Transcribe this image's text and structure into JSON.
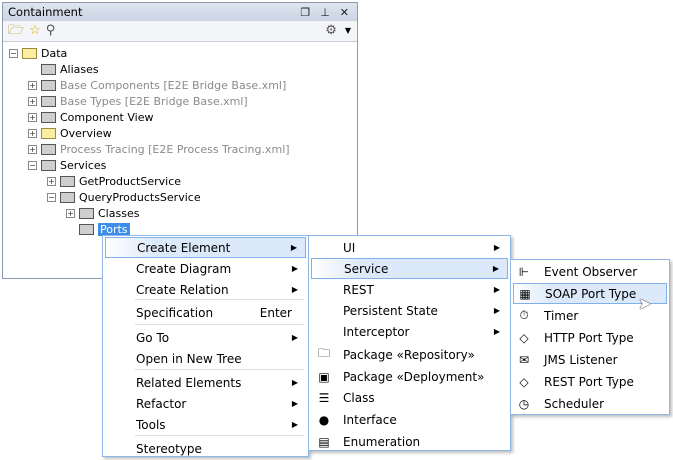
{
  "panel": {
    "title": "Containment",
    "icons": [
      "restore-icon",
      "pin-icon",
      "close-icon"
    ],
    "toolbar": [
      "open-folder-icon",
      "star-icon",
      "search-icon",
      "gear-icon",
      "dropdown-icon"
    ]
  },
  "tree": [
    {
      "label": "Data",
      "level": 0,
      "expander": "minus",
      "folder": "data",
      "style": "normal"
    },
    {
      "label": "Aliases",
      "level": 1,
      "expander": "none",
      "folder": "gray",
      "style": "normal"
    },
    {
      "label": "Base Components [E2E Bridge Base.xml]",
      "level": 1,
      "expander": "plus",
      "folder": "shared",
      "style": "gray"
    },
    {
      "label": "Base Types [E2E Bridge Base.xml]",
      "level": 1,
      "expander": "plus",
      "folder": "shared",
      "style": "gray"
    },
    {
      "label": "Component View",
      "level": 1,
      "expander": "plus",
      "folder": "gray",
      "style": "normal"
    },
    {
      "label": "Overview",
      "level": 1,
      "expander": "plus",
      "folder": "yellow",
      "style": "normal"
    },
    {
      "label": "Process Tracing [E2E Process Tracing.xml]",
      "level": 1,
      "expander": "plus",
      "folder": "shared",
      "style": "gray"
    },
    {
      "label": "Services",
      "level": 1,
      "expander": "minus",
      "folder": "gray",
      "style": "normal"
    },
    {
      "label": "GetProductService",
      "level": 2,
      "expander": "plus",
      "folder": "gray",
      "style": "normal"
    },
    {
      "label": "QueryProductsService",
      "level": 2,
      "expander": "minus",
      "folder": "gray",
      "style": "normal"
    },
    {
      "label": "Classes",
      "level": 3,
      "expander": "plus",
      "folder": "gray",
      "style": "normal"
    },
    {
      "label": "Ports",
      "level": 3,
      "expander": "none",
      "folder": "gray",
      "style": "selected"
    }
  ],
  "menu1": {
    "items": [
      {
        "label": "Create Element",
        "submenu": true,
        "highlighted": true
      },
      {
        "label": "Create Diagram",
        "submenu": true
      },
      {
        "label": "Create Relation",
        "submenu": true
      },
      {
        "label": "Specification",
        "shortcut": "Enter"
      },
      {
        "label": "Go To",
        "submenu": true
      },
      {
        "label": "Open in New Tree"
      },
      {
        "label": "Related Elements",
        "submenu": true
      },
      {
        "label": "Refactor",
        "submenu": true
      },
      {
        "label": "Tools",
        "submenu": true
      },
      {
        "label": "Stereotype"
      }
    ]
  },
  "menu2": {
    "items": [
      {
        "label": "UI",
        "submenu": true
      },
      {
        "label": "Service",
        "submenu": true,
        "highlighted": true
      },
      {
        "label": "REST",
        "submenu": true
      },
      {
        "label": "Persistent State",
        "submenu": true
      },
      {
        "label": "Interceptor",
        "submenu": true
      },
      {
        "label": "Package «Repository»",
        "icon": "package-icon"
      },
      {
        "label": "Package «Deployment»",
        "icon": "deployment-package-icon"
      },
      {
        "label": "Class",
        "icon": "class-icon"
      },
      {
        "label": "Interface",
        "icon": "interface-icon"
      },
      {
        "label": "Enumeration",
        "icon": "enumeration-icon"
      }
    ]
  },
  "menu3": {
    "items": [
      {
        "label": "Event Observer",
        "icon": "event-observer-icon"
      },
      {
        "label": "SOAP Port Type",
        "icon": "soap-port-type-icon",
        "highlighted": true
      },
      {
        "label": "Timer",
        "icon": "timer-icon"
      },
      {
        "label": "HTTP Port Type",
        "icon": "http-port-type-icon"
      },
      {
        "label": "JMS Listener",
        "icon": "jms-listener-icon"
      },
      {
        "label": "REST Port Type",
        "icon": "rest-port-type-icon"
      },
      {
        "label": "Scheduler",
        "icon": "scheduler-icon"
      }
    ]
  },
  "colors": {
    "selection": "#3d8ee6",
    "menu_border": "#8fb6e6",
    "highlight": "#dce9fa"
  }
}
